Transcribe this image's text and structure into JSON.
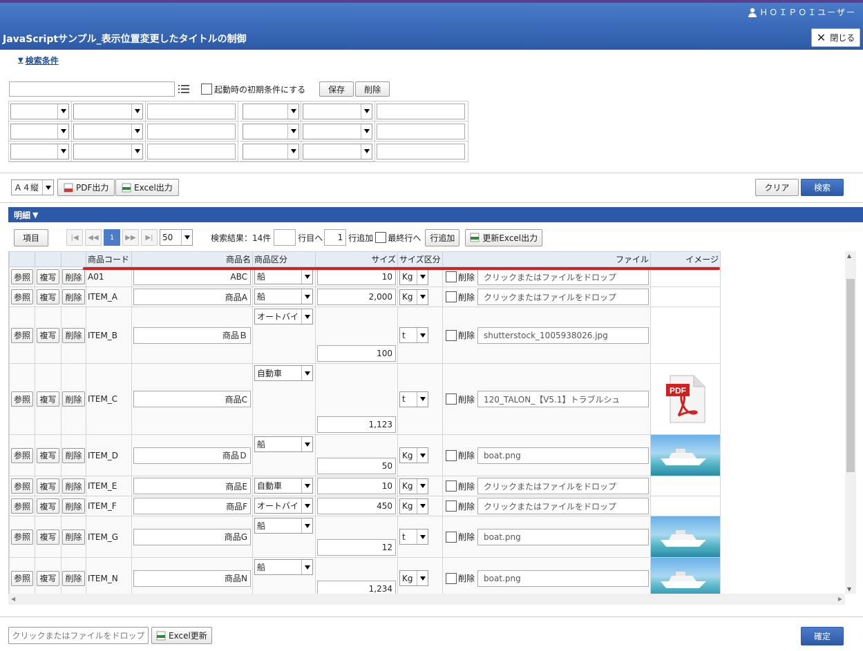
{
  "header": {
    "user": "ＨＯＩＰＯＩユーザー",
    "title": "JavaScriptサンプル_表示位置変更したタイトルの制御",
    "close_label": "閉じる"
  },
  "search": {
    "toggle_label": "検索条件",
    "initial_checkbox_label": "起動時の初期条件にする",
    "save_label": "保存",
    "delete_label": "削除"
  },
  "toolbar": {
    "paper_size": "Ａ４縦",
    "pdf_label": "PDF出力",
    "excel_label": "Excel出力",
    "clear_label": "クリア",
    "search_label": "検索"
  },
  "detail": {
    "title": "明細",
    "item_button": "項目",
    "page_current": "1",
    "page_size": "50",
    "result_text": "検索結果：14件",
    "goto_label": "行目へ",
    "add_count": "1",
    "add_label": "行追加",
    "last_label": "最終行へ",
    "add_row_button": "行追加",
    "update_excel_label": "更新Excel出力"
  },
  "columns": [
    "商品コード",
    "商品名",
    "商品区分",
    "サイズ",
    "サイズ区分",
    "ファイル",
    "イメージ"
  ],
  "row_buttons": {
    "ref": "参照",
    "copy": "複写",
    "del": "削除",
    "file_del": "削除"
  },
  "rows": [
    {
      "code": "A01",
      "name": "ABC",
      "category": "船",
      "size": "10",
      "unit": "Kg",
      "file": "クリックまたはファイルをドロップ",
      "image": ""
    },
    {
      "code": "ITEM_A",
      "name": "商品A",
      "category": "船",
      "size": "2,000",
      "unit": "Kg",
      "file": "クリックまたはファイルをドロップ",
      "image": ""
    },
    {
      "code": "ITEM_B",
      "name": "商品Ｂ",
      "category": "オートバイ",
      "size": "100",
      "unit": "t",
      "file": "shutterstock_1005938026.jpg",
      "image": "still"
    },
    {
      "code": "ITEM_C",
      "name": "商品C",
      "category": "自動車",
      "size": "1,123",
      "unit": "t",
      "file": "120_TALON_【V5.1】トラブルシュ",
      "image": "pdf"
    },
    {
      "code": "ITEM_D",
      "name": "商品Ｄ",
      "category": "船",
      "size": "50",
      "unit": "Kg",
      "file": "boat.png",
      "image": "boat"
    },
    {
      "code": "ITEM_E",
      "name": "商品E",
      "category": "自動車",
      "size": "10",
      "unit": "Kg",
      "file": "クリックまたはファイルをドロップ",
      "image": ""
    },
    {
      "code": "ITEM_F",
      "name": "商品F",
      "category": "オートバイ",
      "size": "450",
      "unit": "Kg",
      "file": "クリックまたはファイルをドロップ",
      "image": ""
    },
    {
      "code": "ITEM_G",
      "name": "商品G",
      "category": "船",
      "size": "12",
      "unit": "t",
      "file": "boat.png",
      "image": "boat"
    },
    {
      "code": "ITEM_N",
      "name": "商品N",
      "category": "船",
      "size": "1,234",
      "unit": "Kg",
      "file": "boat.png",
      "image": "boat"
    }
  ],
  "footer": {
    "drop_label": "クリックまたはファイルをドロップ",
    "excel_update_label": "Excel更新",
    "confirm_label": "確定"
  },
  "colors": {
    "header": "#2d5aa8",
    "accent": "#4a7cc9",
    "marker": "#d81e1e"
  }
}
